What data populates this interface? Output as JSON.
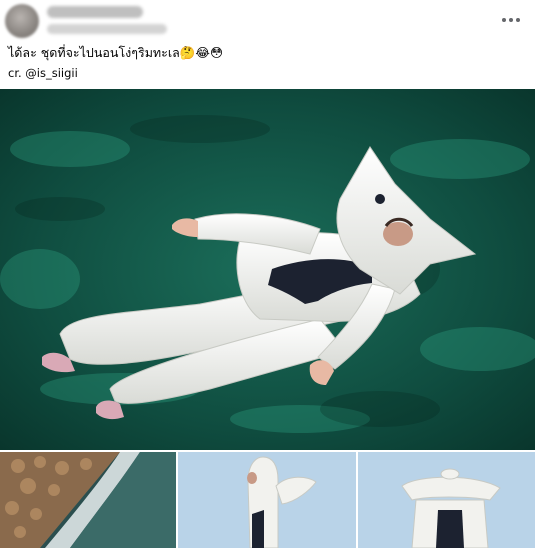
{
  "post": {
    "author_name": "",
    "meta_line": "",
    "caption": "ได้ละ ชุดที่จะไปนอนโง่ๆริมทะเล🤔😂😳",
    "credit": "cr. @is_siigii"
  },
  "colors": {
    "water_dark": "#0a3a30",
    "water_light": "#1f7a63",
    "suit": "#f2f2ee",
    "swimsuit": "#1c2230",
    "sky": "#b9d3e8",
    "icon_gray": "#65676b"
  },
  "icons": {
    "more": "more-horizontal-icon",
    "caption_emojis": [
      "thinking-face",
      "face-with-tears-of-joy",
      "flushed-face"
    ]
  }
}
